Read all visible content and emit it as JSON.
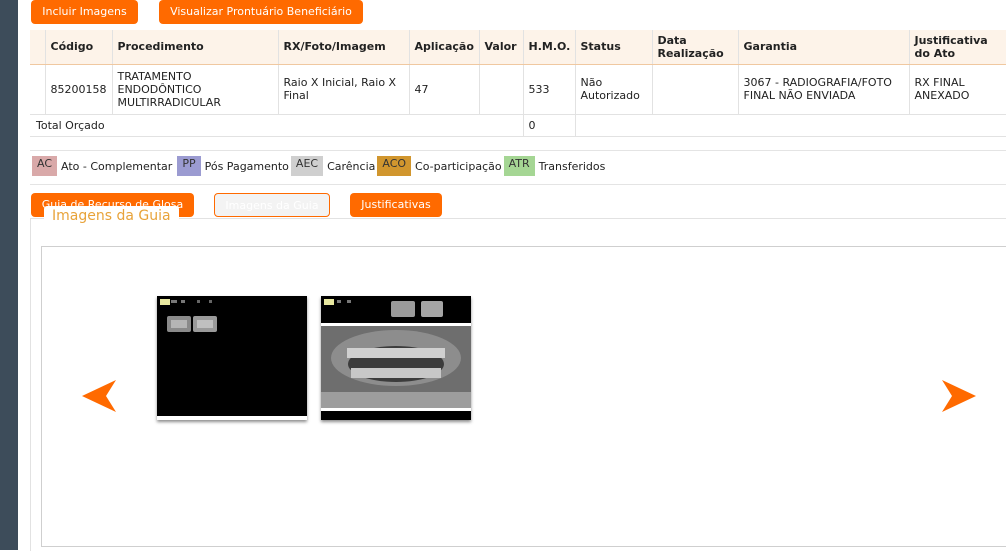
{
  "toolbar": {
    "include_images": "Incluir Imagens",
    "view_record": "Visualizar Prontuário Beneficiário"
  },
  "table": {
    "headers": {
      "codigo": "Código",
      "procedimento": "Procedimento",
      "rx": "RX/Foto/Imagem",
      "aplicacao": "Aplicação",
      "valor": "Valor",
      "hmo": "H.M.O.",
      "status": "Status",
      "data_realizacao": "Data Realização",
      "garantia": "Garantia",
      "justificativa": "Justificativa do Ato"
    },
    "rows": [
      {
        "codigo": "85200158",
        "procedimento": "TRATAMENTO ENDODÔNTICO MULTIRRADICULAR",
        "rx": "Raio X Inicial, Raio X Final",
        "aplicacao": "47",
        "valor": "",
        "hmo": "533",
        "status": "Não Autorizado",
        "data_realizacao": "",
        "garantia": "3067 - RADIOGRAFIA/FOTO FINAL NÃO ENVIADA",
        "justificativa": "RX FINAL ANEXADO"
      }
    ],
    "total_label": "Total Orçado",
    "total_hmo": "0"
  },
  "legend": [
    {
      "code": "AC",
      "label": "Ato - Complementar",
      "color": "#d9a9a9"
    },
    {
      "code": "PP",
      "label": "Pós Pagamento",
      "color": "#9b9bd1"
    },
    {
      "code": "AEC",
      "label": "Carência",
      "color": "#cfcfcf"
    },
    {
      "code": "ACO",
      "label": "Co-participação",
      "color": "#d1962e"
    },
    {
      "code": "ATR",
      "label": "Transferidos",
      "color": "#a5d694"
    }
  ],
  "tabs": {
    "glosa": "Guia de Recurso de Glosa",
    "imagens": "Imagens da Guia",
    "justificativas": "Justificativas"
  },
  "panel": {
    "title": "Imagens da Guia"
  },
  "colors": {
    "accent": "#ff6a00",
    "title": "#e8a33a"
  },
  "icons": {
    "prev": "arrow-left-icon",
    "next": "arrow-right-icon"
  }
}
